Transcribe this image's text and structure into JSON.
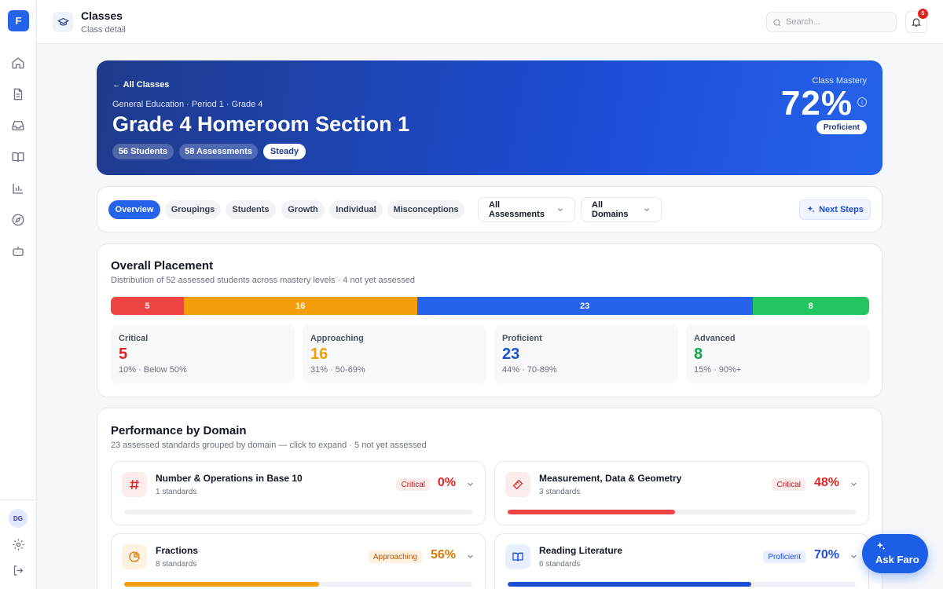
{
  "app": {
    "logo_letter": "F"
  },
  "sidebar": {
    "nav": [
      {
        "name": "home-icon"
      },
      {
        "name": "document-icon"
      },
      {
        "name": "inbox-icon"
      },
      {
        "name": "book-icon"
      },
      {
        "name": "bar-chart-icon"
      },
      {
        "name": "compass-icon"
      },
      {
        "name": "bot-icon"
      }
    ],
    "user_initials": "DG"
  },
  "topbar": {
    "title": "Classes",
    "subtitle": "Class detail",
    "search_placeholder": "Search...",
    "notification_count": "5"
  },
  "hero": {
    "back_label": "← All Classes",
    "meta": "General Education · Period 1 · Grade 4",
    "title": "Grade 4 Homeroom Section 1",
    "pills": [
      "56 Students",
      "58 Assessments",
      "Steady"
    ],
    "mastery_label": "Class Mastery",
    "mastery_value": "72%",
    "mastery_badge": "Proficient"
  },
  "tabs": {
    "items": [
      "Overview",
      "Groupings",
      "Students",
      "Growth",
      "Individual",
      "Misconceptions"
    ],
    "active": "Overview",
    "assessment_filter": "All Assessments",
    "domain_filter": "All Domains",
    "next_steps_label": "Next Steps"
  },
  "placement": {
    "title": "Overall Placement",
    "subtitle": "Distribution of 52 assessed students across mastery levels · 4 not yet assessed",
    "bar": [
      {
        "label": "5",
        "value": 5,
        "color": "#ef4444"
      },
      {
        "label": "16",
        "value": 16,
        "color": "#f59e0b"
      },
      {
        "label": "23",
        "value": 23,
        "color": "#2563eb"
      },
      {
        "label": "8",
        "value": 8,
        "color": "#22c55e"
      }
    ],
    "levels": [
      {
        "name": "Critical",
        "count": "5",
        "desc": "10% · Below 50%",
        "color": "#dc2626"
      },
      {
        "name": "Approaching",
        "count": "16",
        "desc": "31% · 50-69%",
        "color": "#f59e0b"
      },
      {
        "name": "Proficient",
        "count": "23",
        "desc": "44% · 70-89%",
        "color": "#1d4ed8"
      },
      {
        "name": "Advanced",
        "count": "8",
        "desc": "15% · 90%+",
        "color": "#16a34a"
      }
    ]
  },
  "domains": {
    "title": "Performance by Domain",
    "subtitle": "23 assessed standards grouped by domain — click to expand · 5 not yet assessed",
    "items": [
      {
        "name": "Number & Operations in Base 10",
        "standards": "1 standards",
        "status": "Critical",
        "percent": "0%",
        "progress": 0,
        "icon": "hash-icon",
        "color": "#dc2626",
        "bar_color": "#ef4444",
        "status_bg": "#fdecec",
        "icon_bg": "#fdecec"
      },
      {
        "name": "Measurement, Data & Geometry",
        "standards": "3 standards",
        "status": "Critical",
        "percent": "48%",
        "progress": 0.48,
        "icon": "ruler-icon",
        "color": "#dc2626",
        "bar_color": "#ef4444",
        "status_bg": "#fdecec",
        "icon_bg": "#fdecec"
      },
      {
        "name": "Fractions",
        "standards": "8 standards",
        "status": "Approaching",
        "percent": "56%",
        "progress": 0.56,
        "icon": "pie-chart-icon",
        "color": "#d97706",
        "bar_color": "#f59e0b",
        "status_bg": "#fef3e2",
        "icon_bg": "#fef3e2"
      },
      {
        "name": "Reading Literature",
        "standards": "6 standards",
        "status": "Proficient",
        "percent": "70%",
        "progress": 0.7,
        "icon": "open-book-icon",
        "color": "#1d4ed8",
        "bar_color": "#1d4ed8",
        "status_bg": "#e8efff",
        "icon_bg": "#e8efff"
      }
    ]
  },
  "assistant": {
    "label": "Ask Faro"
  }
}
